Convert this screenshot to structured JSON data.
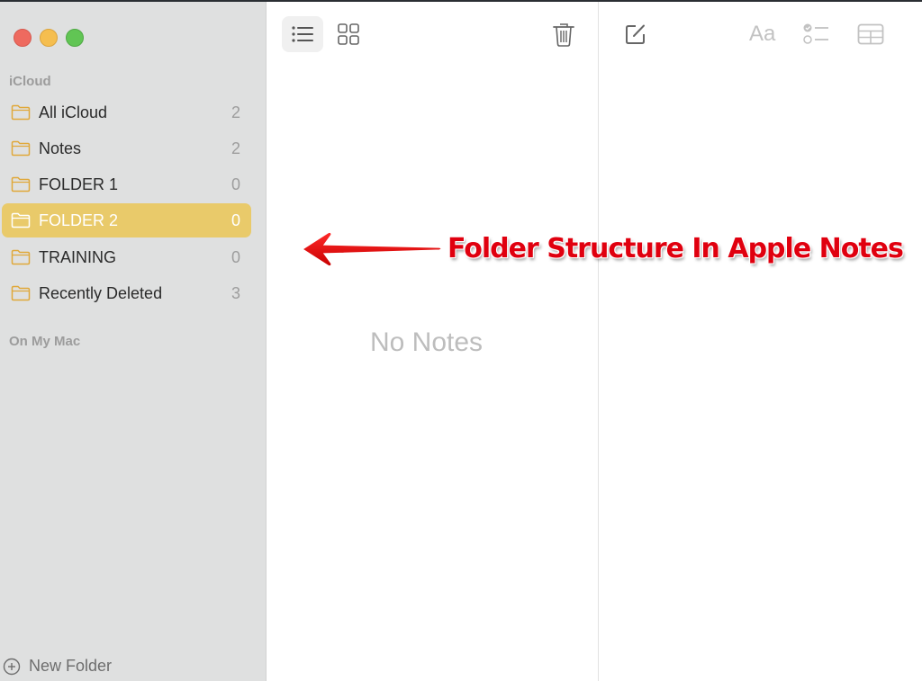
{
  "window": {
    "traffic_lights": [
      "close",
      "minimize",
      "zoom"
    ]
  },
  "sidebar": {
    "sections": [
      {
        "label": "iCloud"
      },
      {
        "label": "On My Mac"
      }
    ],
    "folders": [
      {
        "name": "All iCloud",
        "count": "2",
        "selected": false
      },
      {
        "name": "Notes",
        "count": "2",
        "selected": false
      },
      {
        "name": "FOLDER 1",
        "count": "0",
        "selected": false
      },
      {
        "name": "FOLDER 2",
        "count": "0",
        "selected": true
      },
      {
        "name": "TRAINING",
        "count": "0",
        "selected": false
      },
      {
        "name": "Recently Deleted",
        "count": "3",
        "selected": false
      }
    ],
    "new_folder_label": "New Folder",
    "colors": {
      "selected": "#e9ca6a",
      "folder_icon": "#e0a83a"
    }
  },
  "list_pane": {
    "toolbar": {
      "list_view": "list-view-icon",
      "gallery_view": "gallery-view-icon",
      "delete": "trash-icon"
    },
    "empty_text": "No Notes"
  },
  "editor": {
    "toolbar": {
      "compose": "compose-icon",
      "format_label": "Aa",
      "checklist": "checklist-icon",
      "table": "table-icon"
    }
  },
  "annotation": {
    "text": "Folder Structure In Apple Notes",
    "color": "#e0000f"
  }
}
